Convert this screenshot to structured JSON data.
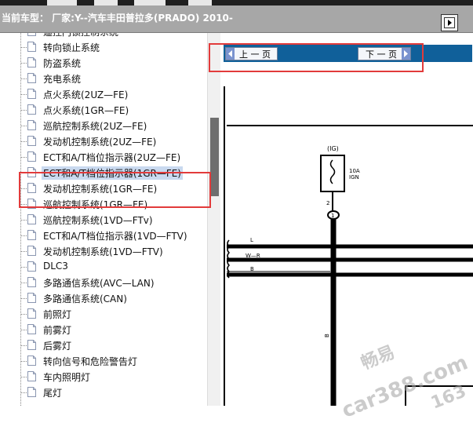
{
  "header": {
    "title": "当前车型：  厂家:Y--汽车丰田普拉多(PRADO) 2010-"
  },
  "tree": {
    "items": [
      {
        "label": "遥控门锁控制系统"
      },
      {
        "label": "转向锁止系统"
      },
      {
        "label": "防盗系统"
      },
      {
        "label": "充电系统"
      },
      {
        "label": "点火系统(2UZ—FE)"
      },
      {
        "label": "点火系统(1GR—FE)"
      },
      {
        "label": "巡航控制系统(2UZ—FE)"
      },
      {
        "label": "发动机控制系统(2UZ—FE)"
      },
      {
        "label": "ECT和A/T档位指示器(2UZ—FE)"
      },
      {
        "label": "ECT和A/T档位指示器(1GR—FE)",
        "selected": true
      },
      {
        "label": "发动机控制系统(1GR—FE)"
      },
      {
        "label": "巡航控制系统(1GR—FE)"
      },
      {
        "label": "巡航控制系统(1VD—FTv)"
      },
      {
        "label": "ECT和A/T档位指示器(1VD—FTV)"
      },
      {
        "label": "发动机控制系统(1VD—FTV)"
      },
      {
        "label": "DLC3"
      },
      {
        "label": "多路通信系统(AVC—LAN)"
      },
      {
        "label": "多路通信系统(CAN)"
      },
      {
        "label": "前照灯"
      },
      {
        "label": "前雾灯"
      },
      {
        "label": "后雾灯"
      },
      {
        "label": "转向信号和危险警告灯"
      },
      {
        "label": "车内照明灯"
      },
      {
        "label": "尾灯"
      }
    ]
  },
  "toolbar": {
    "prev_label": "上 一 页",
    "next_label": "下 一 页"
  },
  "diagram": {
    "fuse_top": "(IG)",
    "fuse_rating": "10A",
    "fuse_name": "IGN",
    "pin": "2",
    "connector": "1",
    "wire_l": "L",
    "wire_wr": "W—R",
    "wire_b": "B",
    "wire_br": "B"
  },
  "watermark": {
    "text1": "畅易",
    "text2": "car388.com",
    "text3": "163"
  }
}
